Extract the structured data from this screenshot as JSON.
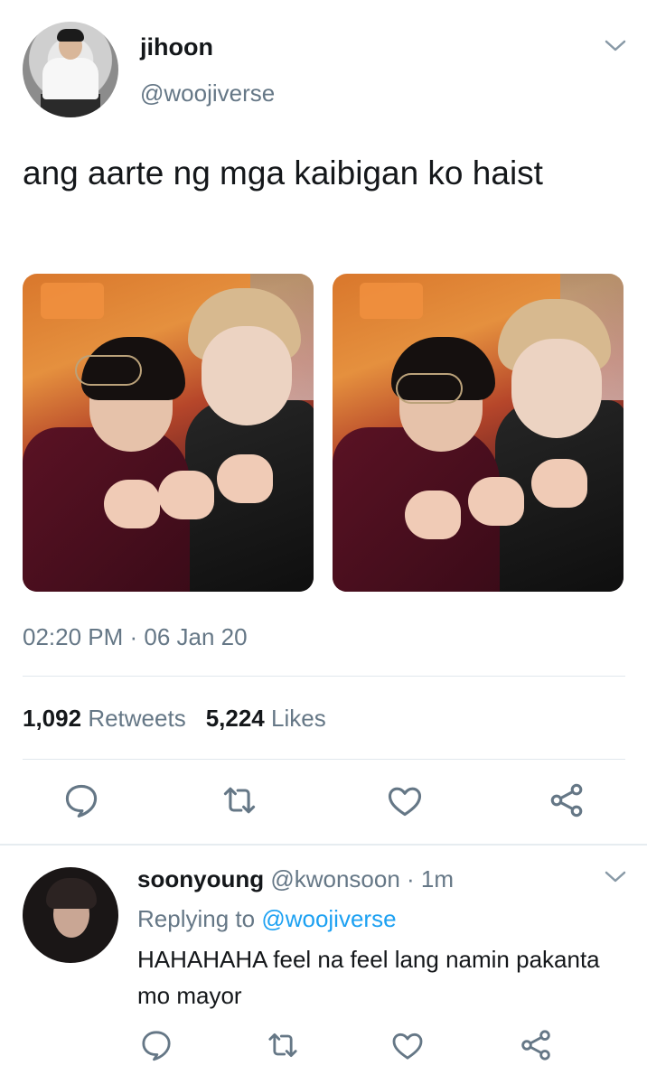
{
  "tweet": {
    "display_name": "jihoon",
    "handle": "@woojiverse",
    "text": "ang aarte ng mga kaibigan ko haist",
    "timestamp": "02:20 PM · 06 Jan 20",
    "retweets_count": "1,092",
    "retweets_label": "Retweets",
    "likes_count": "5,224",
    "likes_label": "Likes",
    "actions": [
      "reply-icon",
      "retweet-icon",
      "like-icon",
      "share-icon"
    ]
  },
  "reply": {
    "display_name": "soonyoung",
    "handle": "@kwonsoon",
    "time_ago": "· 1m",
    "replying_prefix": "Replying to",
    "replying_to": "@woojiverse",
    "text": "HAHAHAHA feel na feel lang namin pakanta mo mayor"
  },
  "colors": {
    "text_primary": "#14171a",
    "text_secondary": "#657786",
    "link": "#1da1f2",
    "divider": "#e1e8ed"
  }
}
